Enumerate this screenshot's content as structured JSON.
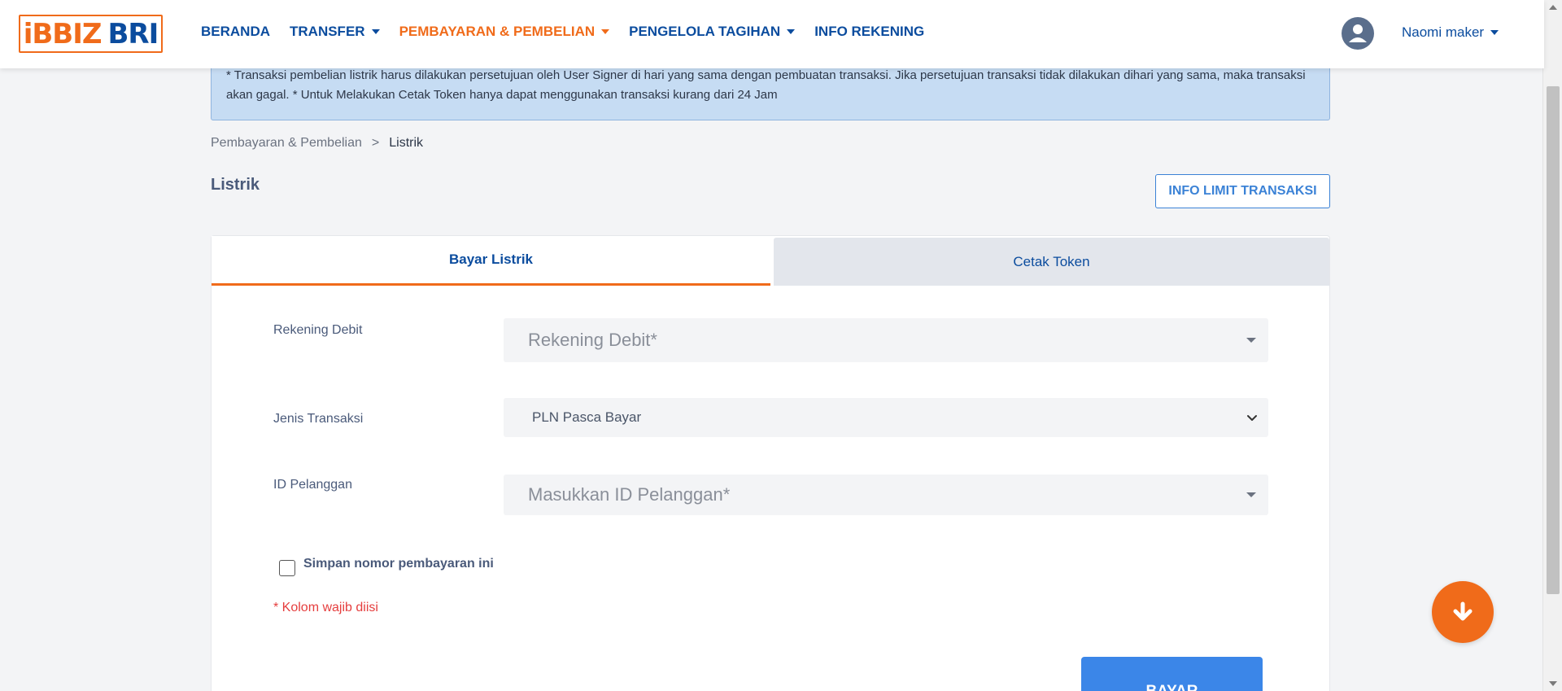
{
  "navbar": {
    "logo_part1": "iBBIZ",
    "logo_part2": "BRI",
    "items": [
      {
        "label": "BERANDA"
      },
      {
        "label": "TRANSFER"
      },
      {
        "label": "PEMBAYARAN & PEMBELIAN"
      },
      {
        "label": "PENGELOLA TAGIHAN"
      },
      {
        "label": "INFO REKENING"
      }
    ],
    "user_name": "Naomi maker"
  },
  "alert": {
    "text": "* Transaksi pembelian listrik harus dilakukan persetujuan oleh User Signer di hari yang sama dengan pembuatan transaksi. Jika persetujuan transaksi tidak dilakukan dihari yang sama, maka transaksi akan gagal. * Untuk Melakukan Cetak Token hanya dapat menggunakan transaksi kurang dari 24 Jam"
  },
  "breadcrumb": {
    "parent": "Pembayaran & Pembelian",
    "separator": ">",
    "current": "Listrik"
  },
  "page": {
    "title": "Listrik",
    "info_limit_label": "INFO LIMIT TRANSAKSI"
  },
  "tabs": {
    "bayar": "Bayar Listrik",
    "cetak": "Cetak Token"
  },
  "form": {
    "rekening_label": "Rekening Debit",
    "rekening_placeholder": "Rekening Debit*",
    "jenis_label": "Jenis Transaksi",
    "jenis_value": "PLN Pasca Bayar",
    "id_label": "ID Pelanggan",
    "id_placeholder": "Masukkan ID Pelanggan*",
    "save_label": "Simpan nomor pembayaran ini",
    "save_checked": false,
    "required_note": "* Kolom wajib diisi",
    "submit_label": "BAYAR"
  },
  "colors": {
    "brand_blue": "#0b4c9e",
    "brand_orange": "#f06b1a",
    "button_blue": "#3b86e8",
    "error_red": "#e53e3e"
  },
  "icons": {
    "avatar": "user-icon",
    "fab": "arrow-down-icon"
  }
}
